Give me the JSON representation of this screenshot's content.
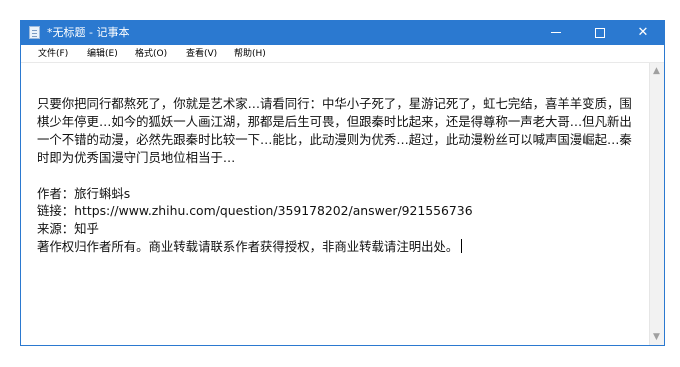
{
  "window": {
    "title": "*无标题 - 记事本",
    "icon": "notepad-icon",
    "controls": {
      "minimize": "minimize-icon",
      "maximize": "maximize-icon",
      "close": "✕"
    }
  },
  "menu": {
    "file": "文件(F)",
    "edit": "编辑(E)",
    "format": "格式(O)",
    "view": "查看(V)",
    "help": "帮助(H)"
  },
  "editor": {
    "content": "只要你把同行都熬死了，你就是艺术家…请看同行：中华小子死了，星游记死了，虹七完结，喜羊羊变质，围棋少年停更…如今的狐妖一人画江湖，那都是后生可畏，但跟秦时比起来，还是得尊称一声老大哥…但凡新出一个不错的动漫，必然先跟秦时比较一下…能比，此动漫则为优秀…超过，此动漫粉丝可以喊声国漫崛起…秦时即为优秀国漫守门员地位相当于…\n\n作者：旅行蝌蚪s\n链接：https://www.zhihu.com/question/359178202/answer/921556736\n来源：知乎\n著作权归作者所有。商业转载请联系作者获得授权，非商业转载请注明出处。"
  },
  "scrollbar": {
    "up": "▲",
    "down": "▼"
  },
  "colors": {
    "titlebar": "#2b79d0",
    "text": "#111111"
  }
}
